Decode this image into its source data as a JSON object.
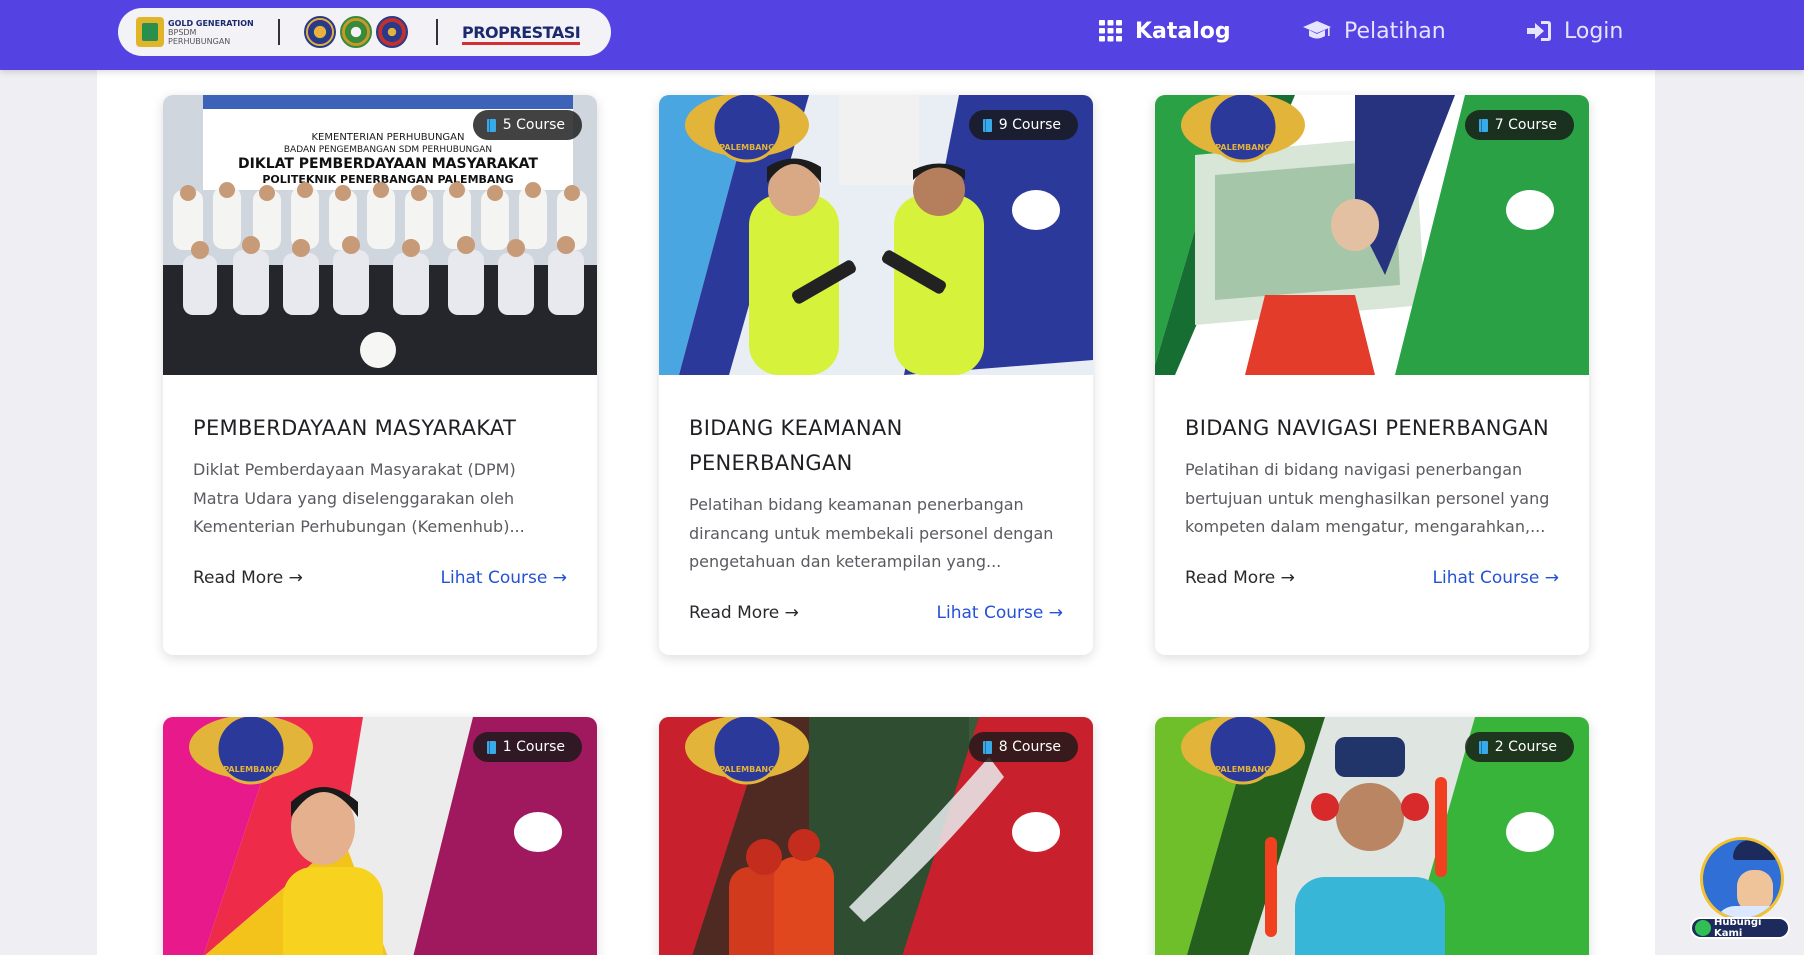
{
  "navbar": {
    "logos": {
      "gold_generation_line1": "GOLD GENERATION",
      "gold_generation_line2": "BPSDM PERHUBUNGAN",
      "prestasi": "PROPRESTASI"
    },
    "menu": [
      {
        "label": "Katalog",
        "icon": "grid-icon"
      },
      {
        "label": "Pelatihan",
        "icon": "graduation-cap-icon"
      },
      {
        "label": "Login",
        "icon": "sign-in-icon"
      }
    ]
  },
  "cards": [
    {
      "badge": "5 Course",
      "title": "PEMBERDAYAAN MASYARAKAT",
      "desc_lines": [
        "Diklat Pemberdayaan Masyarakat (DPM)",
        "Matra Udara yang diselenggarakan oleh",
        "Kementerian Perhubungan (Kemenhub)..."
      ],
      "read_more": "Read More →",
      "lihat": "Lihat Course →",
      "banner_lines": [
        "KEMENTERIAN PERHUBUNGAN",
        "BADAN PENGEMBANGAN SDM PERHUBUNGAN",
        "DIKLAT PEMBERDAYAAN MASYARAKAT",
        "POLITEKNIK PENERBANGAN PALEMBANG"
      ]
    },
    {
      "badge": "9 Course",
      "title_lines": [
        "BIDANG KEAMANAN",
        "PENERBANGAN"
      ],
      "desc_lines": [
        "Pelatihan bidang keamanan penerbangan",
        "dirancang untuk membekali personel dengan",
        "pengetahuan dan keterampilan yang..."
      ],
      "read_more": "Read More →",
      "lihat": "Lihat Course →",
      "emblem_text": "PALEMBANG"
    },
    {
      "badge": "7 Course",
      "title": "BIDANG NAVIGASI PENERBANGAN",
      "desc_lines": [
        "Pelatihan di bidang navigasi penerbangan",
        "bertujuan untuk menghasilkan personel yang",
        "kompeten dalam mengatur, mengarahkan,..."
      ],
      "read_more": "Read More →",
      "lihat": "Lihat Course →",
      "emblem_text": "PALEMBANG"
    },
    {
      "badge": "1 Course",
      "emblem_text": "PALEMBANG"
    },
    {
      "badge": "8 Course",
      "emblem_text": "PALEMBANG"
    },
    {
      "badge": "2 Course",
      "emblem_text": "PALEMBANG"
    }
  ],
  "floating": {
    "label": "Hubungi Kami"
  },
  "colors": {
    "navbar": "#5542e3",
    "link": "#2452d6",
    "blue_theme": "#2b3a9a",
    "green_theme": "#2aa145",
    "magenta_theme": "#a0195e",
    "red_theme": "#c9202e",
    "lime_theme": "#38b43a"
  }
}
